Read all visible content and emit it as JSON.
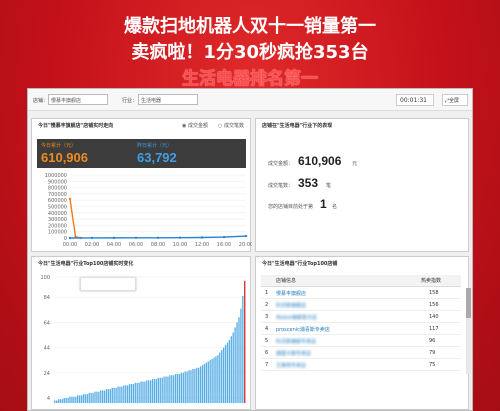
{
  "headline": {
    "line1": "爆款扫地机器人双十一销量第一",
    "line2": "卖疯啦！1分30秒疯抢353台",
    "line3": "生活电器排名第一"
  },
  "toolbar": {
    "shop_label": "店铺：",
    "shop_value": "慢慕丰旗舰店",
    "industry_label": "行业：",
    "industry_value": "生活电器",
    "timer": "00:01:31",
    "fullscreen": "全屏"
  },
  "trend_panel": {
    "title": "今日\"慢慕丰旗舰店\"店铺实时走向",
    "radio_amount": "成交金额",
    "radio_count": "成交笔数",
    "today_label": "今日累计（元）",
    "today_value": "610,906",
    "yesterday_label": "昨日累计（元）",
    "yesterday_value": "63,792"
  },
  "industry_panel": {
    "title": "店铺在\"生活电器\"行业下的表现",
    "amount_label": "成交金额：",
    "amount_value": "610,906",
    "amount_unit": "元",
    "count_label": "成交笔数：",
    "count_value": "353",
    "count_unit": "笔",
    "rank_label": "您的店铺目前处于第",
    "rank_value": "1",
    "rank_unit": "名"
  },
  "top100_chart_panel": {
    "title": "今日\"生活电器\"行业Top100店铺实时变化"
  },
  "top100_table_panel": {
    "title": "今日\"生活电器\"行业Top100店铺",
    "col_shop": "店铺信息",
    "col_heat": "热卖指数",
    "rows": [
      {
        "rank": "1",
        "shop": "慢慕丰旗舰店",
        "heat": "158"
      },
      {
        "rank": "2",
        "shop": "科沃斯旗舰店",
        "heat": "156"
      },
      {
        "rank": "3",
        "shop": "iRobot旗舰官方店",
        "heat": "140"
      },
      {
        "rank": "4",
        "shop": "proscenic浦喜斯专卖店",
        "heat": "117"
      },
      {
        "rank": "5",
        "shop": "科沃斯旗舰专卖店",
        "heat": "96"
      },
      {
        "rank": "6",
        "shop": "德国卡赫专卖店",
        "heat": "79"
      },
      {
        "rank": "7",
        "shop": "艾美特专卖店",
        "heat": "75"
      }
    ]
  },
  "chart_data": [
    {
      "type": "line",
      "title": "今日\"慢慕丰旗舰店\"店铺实时走向",
      "x_ticks": [
        "00:00",
        "02:00",
        "04:00",
        "06:00",
        "08:00",
        "10:00",
        "12:00",
        "16:00",
        "20:00"
      ],
      "y_ticks": [
        "1000000",
        "900000",
        "800000",
        "700000",
        "600000",
        "500000",
        "400000",
        "300000",
        "200000",
        "100000",
        "0"
      ],
      "ylim": [
        0,
        1000000
      ],
      "series": [
        {
          "color": "#f07b1a",
          "x": [
            "00:00",
            "00:30",
            "01:00"
          ],
          "y": [
            620000,
            20000,
            0
          ]
        },
        {
          "color": "#2a84d2",
          "x": [
            "00:00",
            "02:00",
            "04:00",
            "06:00",
            "08:00",
            "10:00",
            "12:00",
            "16:00",
            "20:00"
          ],
          "y": [
            0,
            1000,
            2000,
            2500,
            3000,
            5000,
            8000,
            15000,
            30000
          ]
        }
      ]
    },
    {
      "type": "bar",
      "title": "今日\"生活电器\"行业Top100店铺实时变化",
      "y_ticks": [
        "100",
        "84",
        "64",
        "44",
        "24",
        "4"
      ],
      "ylim": [
        0,
        100
      ],
      "values": [
        2,
        2,
        3,
        3,
        3,
        4,
        4,
        4,
        5,
        5,
        5,
        5,
        6,
        6,
        6,
        7,
        7,
        7,
        8,
        8,
        8,
        9,
        9,
        9,
        10,
        10,
        10,
        11,
        11,
        11,
        12,
        12,
        12,
        13,
        13,
        13,
        14,
        14,
        14,
        15,
        15,
        15,
        16,
        16,
        16,
        17,
        17,
        17,
        18,
        18,
        18,
        19,
        19,
        19,
        20,
        20,
        20,
        21,
        21,
        21,
        22,
        22,
        22,
        23,
        23,
        23,
        24,
        24,
        25,
        25,
        26,
        26,
        27,
        27,
        28,
        28,
        29,
        30,
        31,
        32,
        33,
        34,
        35,
        36,
        37,
        38,
        40,
        42,
        44,
        46,
        48,
        50,
        53,
        56,
        60,
        64,
        68,
        75,
        85,
        97
      ]
    }
  ]
}
